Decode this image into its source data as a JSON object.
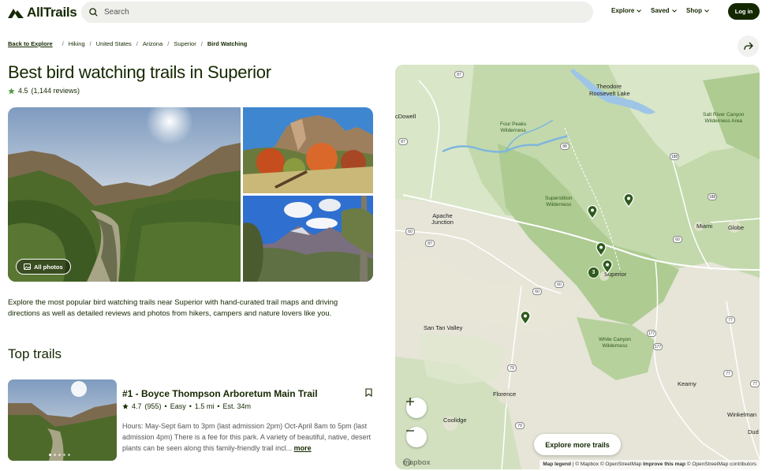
{
  "header": {
    "logo_text": "AllTrails",
    "search_placeholder": "Search",
    "nav": [
      {
        "label": "Explore"
      },
      {
        "label": "Saved"
      },
      {
        "label": "Shop"
      }
    ],
    "login_label": "Log in"
  },
  "breadcrumb": {
    "back_label": "Back to Explore",
    "items": [
      "Hiking",
      "United States",
      "Arizona",
      "Superior"
    ],
    "current": "Bird Watching"
  },
  "page": {
    "title": "Best bird watching trails in Superior",
    "rating": "4.5",
    "reviews": "(1,144 reviews)",
    "all_photos_label": "All photos",
    "description": "Explore the most popular bird watching trails near Superior with hand-curated trail maps and driving directions as well as detailed reviews and photos from hikers, campers and nature lovers like you.",
    "top_trails_heading": "Top trails"
  },
  "trail": {
    "name": "#1 - Boyce Thompson Arboretum Main Trail",
    "rating": "4.7",
    "review_count": "(955)",
    "difficulty": "Easy",
    "length": "1.5 mi",
    "duration": "Est. 34m",
    "description": "Hours: May-Sept 6am to 3pm (last admission 2pm) Oct-April 8am to 5pm (last admission 4pm) There is a fee for this park. A variety of beautiful, native, desert plants can be seen along this family-friendly trail incl...",
    "more_label": "more"
  },
  "map": {
    "explore_more_label": "Explore more trails",
    "mapbox_label": "mapbox",
    "attribution": {
      "legend": "Map legend",
      "mapbox": "© Mapbox",
      "osm": "© OpenStreetMap",
      "improve": "Improve this map",
      "osm2": "© OpenStreetMap contributors"
    },
    "labels": {
      "theodore": "Theodore",
      "roosevelt": "Roosevelt Lake",
      "mcdowell": "cDowell",
      "four_peaks_1": "Four Peaks",
      "four_peaks_2": "Wilderness",
      "salt_river_1": "Salt River Canyon",
      "salt_river_2": "Wilderness Area",
      "superstition_1": "Superstition",
      "superstition_2": "Wilderness",
      "apache_1": "Apache",
      "apache_2": "Junction",
      "miami": "Miami",
      "globe": "Globe",
      "superior": "Superior",
      "san_tan": "San Tan Valley",
      "white_canyon_1": "White Canyon",
      "white_canyon_2": "Wilderness",
      "florence": "Florence",
      "kearny": "Kearny",
      "coolidge": "Coolidge",
      "winkelman": "Winkelman",
      "dud": "Dud"
    },
    "highways": [
      "87",
      "87",
      "88",
      "188",
      "188",
      "60",
      "60",
      "60",
      "60",
      "79",
      "79",
      "77",
      "77",
      "77",
      "177",
      "177",
      "87"
    ],
    "cluster_count": "3"
  }
}
